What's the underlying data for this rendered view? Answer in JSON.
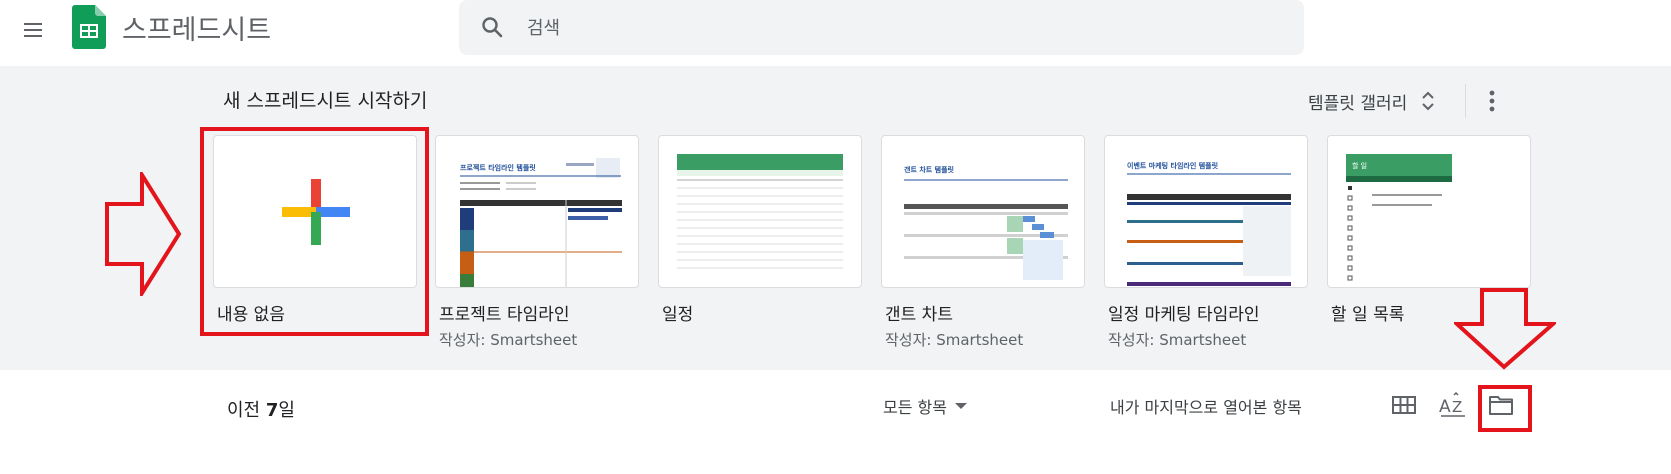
{
  "header": {
    "app_title": "스프레드시트",
    "search_placeholder": "검색",
    "icons": [
      "menu-icon",
      "sheets-logo-icon",
      "search-icon"
    ]
  },
  "templates": {
    "section_title": "새 스프레드시트 시작하기",
    "gallery_label": "템플릿 갤러리",
    "items": [
      {
        "name": "내용 없음",
        "author": ""
      },
      {
        "name": "프로젝트 타임라인",
        "author": "작성자: Smartsheet",
        "thumb_title": "프로젝트 타임라인 템플릿"
      },
      {
        "name": "일정",
        "author": "",
        "thumb_title": ""
      },
      {
        "name": "갠트 차트",
        "author": "작성자: Smartsheet",
        "thumb_title": "갠트 차트 템플릿"
      },
      {
        "name": "일정 마케팅 타임라인",
        "author": "작성자: Smartsheet",
        "thumb_title": "이벤트 마케팅 타임라인 템플릿"
      },
      {
        "name": "할 일 목록",
        "author": "",
        "thumb_title": "할 일"
      }
    ]
  },
  "recent": {
    "title_prefix": "이전 ",
    "title_bold": "7",
    "title_suffix": "일",
    "owner_filter": "모든 항목",
    "sort_label": "내가 마지막으로 열어본 항목",
    "icons": [
      "grid-view-icon",
      "sort-az-icon",
      "folder-icon"
    ]
  },
  "colors": {
    "accent_red": "#e3141b",
    "sheets_green": "#0f9d58",
    "background_gray": "#f1f3f4"
  }
}
